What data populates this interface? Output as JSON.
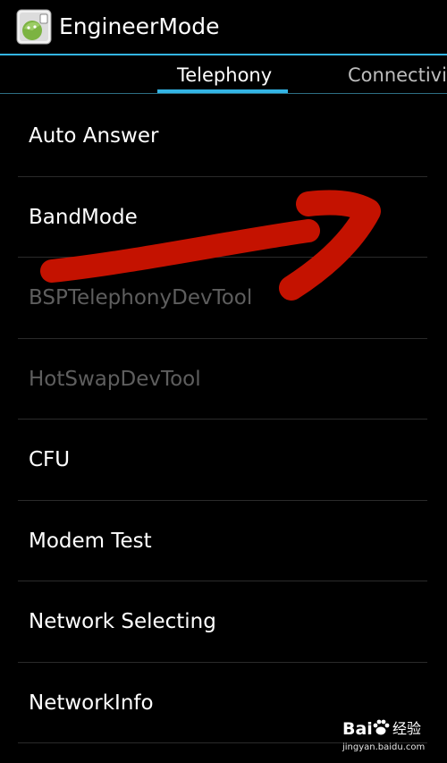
{
  "app": {
    "title": "EngineerMode",
    "icon": "android-icon"
  },
  "tabs": [
    {
      "label": "Telephony",
      "selected": true
    },
    {
      "label": "Connectivit",
      "selected": false
    }
  ],
  "list": {
    "items": [
      {
        "label": "Auto Answer",
        "enabled": true
      },
      {
        "label": "BandMode",
        "enabled": true
      },
      {
        "label": "BSPTelephonyDevTool",
        "enabled": false
      },
      {
        "label": "HotSwapDevTool",
        "enabled": false
      },
      {
        "label": "CFU",
        "enabled": true
      },
      {
        "label": "Modem Test",
        "enabled": true
      },
      {
        "label": "Network Selecting",
        "enabled": true
      },
      {
        "label": "NetworkInfo",
        "enabled": true
      }
    ]
  },
  "annotation": {
    "icon": "red-arrow-icon",
    "color": "#c41200"
  },
  "watermark": {
    "brand_left": "Bai",
    "brand_right": "经验",
    "url": "jingyan.baidu.com"
  },
  "colors": {
    "accent": "#33b5e5",
    "background": "#000000",
    "text": "#ffffff",
    "disabled_text": "#5e5e5e"
  }
}
